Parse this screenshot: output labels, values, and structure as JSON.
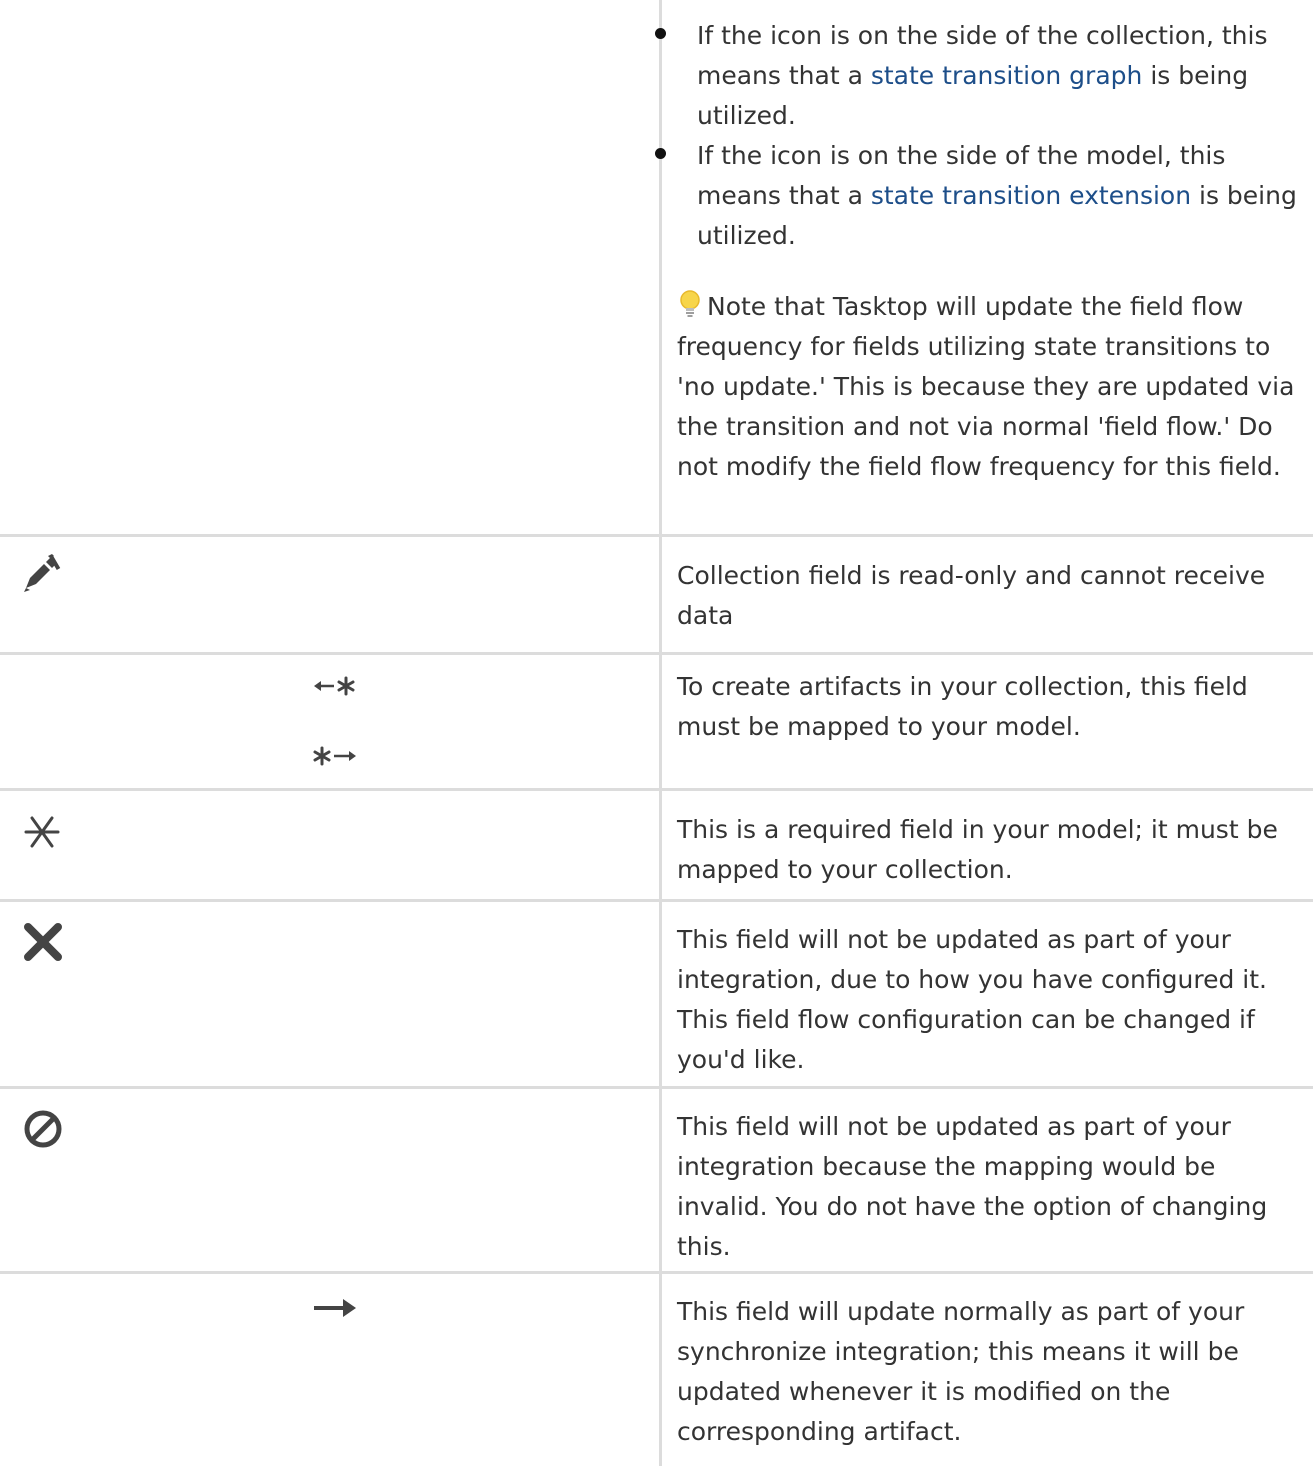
{
  "bullets": [
    {
      "before": "If the icon is on the side of the collection, this means that a ",
      "link": "state transition graph",
      "after": " is being utilized."
    },
    {
      "before": "If the icon is on the side of the model, this means that a ",
      "link": "state transition extension",
      "after": " is being utilized."
    }
  ],
  "note": {
    "icon": "lightbulb-icon",
    "text": "Note that Tasktop will update the field flow frequency for fields utilizing state transitions to 'no update.' This is because they are updated via the transition and not via normal 'field flow.' Do not modify the field flow frequency for this field."
  },
  "rows": [
    {
      "icon": "pencil-slash-icon",
      "description": "Collection field is read-only and cannot receive data"
    },
    {
      "icon": "arrow-asterisk-icons",
      "description": "To create artifacts in your collection, this field must be mapped to your model."
    },
    {
      "icon": "asterisk-icon",
      "description": "This is a required field in your model; it must be mapped to your collection."
    },
    {
      "icon": "x-icon",
      "description": "This field will not be updated as part of your integration, due to how you have configured it. This field flow configuration can be changed if you'd like."
    },
    {
      "icon": "prohibited-icon",
      "description": "This field will not be updated as part of your integration because the mapping would be invalid. You do not have the option of changing this."
    },
    {
      "icon": "arrow-right-icon",
      "description": "This field will update normally as part of your synchronize integration; this means it will be updated whenever it is modified on the corresponding artifact."
    }
  ],
  "colors": {
    "text": "#333333",
    "link": "#1d4e89",
    "grid": "#dcdcdc",
    "icon": "#444444"
  }
}
